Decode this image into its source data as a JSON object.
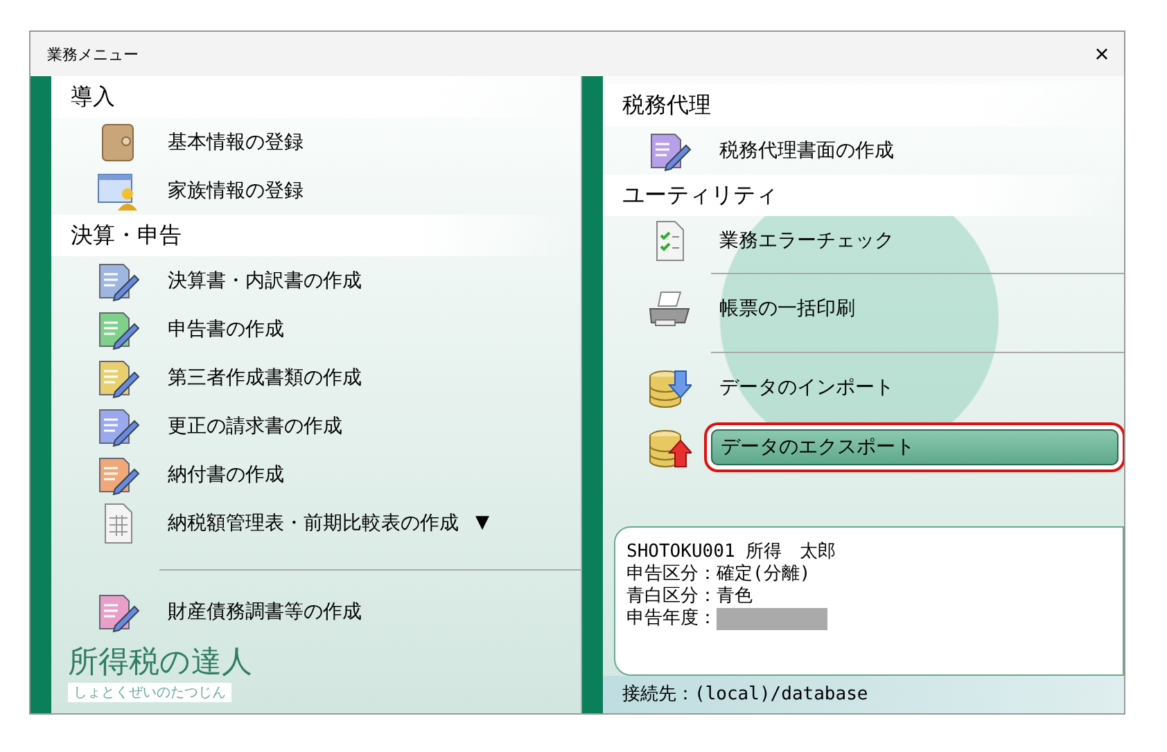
{
  "window": {
    "title": "業務メニュー",
    "close": "×"
  },
  "left_sections": [
    {
      "title": "導入",
      "items": [
        {
          "label": "基本情報の登録",
          "kind": "book"
        },
        {
          "label": "家族情報の登録",
          "kind": "family"
        }
      ]
    },
    {
      "title": "決算・申告",
      "items": [
        {
          "label": "決算書・内訳書の作成",
          "kind": "statement"
        },
        {
          "label": "申告書の作成",
          "kind": "form"
        },
        {
          "label": "第三者作成書類の作成",
          "kind": "table"
        },
        {
          "label": "更正の請求書の作成",
          "kind": "correction"
        },
        {
          "label": "納付書の作成",
          "kind": "payment"
        },
        {
          "label": "納税額管理表・前期比較表の作成",
          "kind": "sheet",
          "arrow": "▼"
        },
        {
          "label": "財産債務調書等の作成",
          "kind": "property",
          "divider_before": true
        }
      ]
    }
  ],
  "logo": {
    "title": "所得税の達人",
    "subtitle": "しょとくぜいのたつじん"
  },
  "right_sections": [
    {
      "title": "税務代理",
      "items": [
        {
          "label": "税務代理書面の作成",
          "kind": "agent",
          "selected": false,
          "outlined": false
        }
      ]
    },
    {
      "title": "ユーティリティ",
      "items": [
        {
          "label": "業務エラーチェック",
          "kind": "check",
          "selected": false,
          "outlined": false
        },
        {
          "label": "帳票の一括印刷",
          "kind": "print",
          "selected": false,
          "outlined": false,
          "divider_before": true
        },
        {
          "label": "データのインポート",
          "kind": "import",
          "selected": false,
          "outlined": false,
          "divider_before": true
        },
        {
          "label": "データのエクスポート",
          "kind": "export",
          "selected": true,
          "outlined": true
        }
      ]
    }
  ],
  "info": {
    "lines": [
      {
        "text": "SHOTOKU001 所得　太郎",
        "redacted": false
      },
      {
        "text": "申告区分：確定(分離)",
        "redacted": false
      },
      {
        "text": "青白区分：青色",
        "redacted": false
      },
      {
        "text": "申告年度：",
        "redacted": true
      }
    ]
  },
  "status_bar": {
    "text": "接続先：(local)/database"
  }
}
